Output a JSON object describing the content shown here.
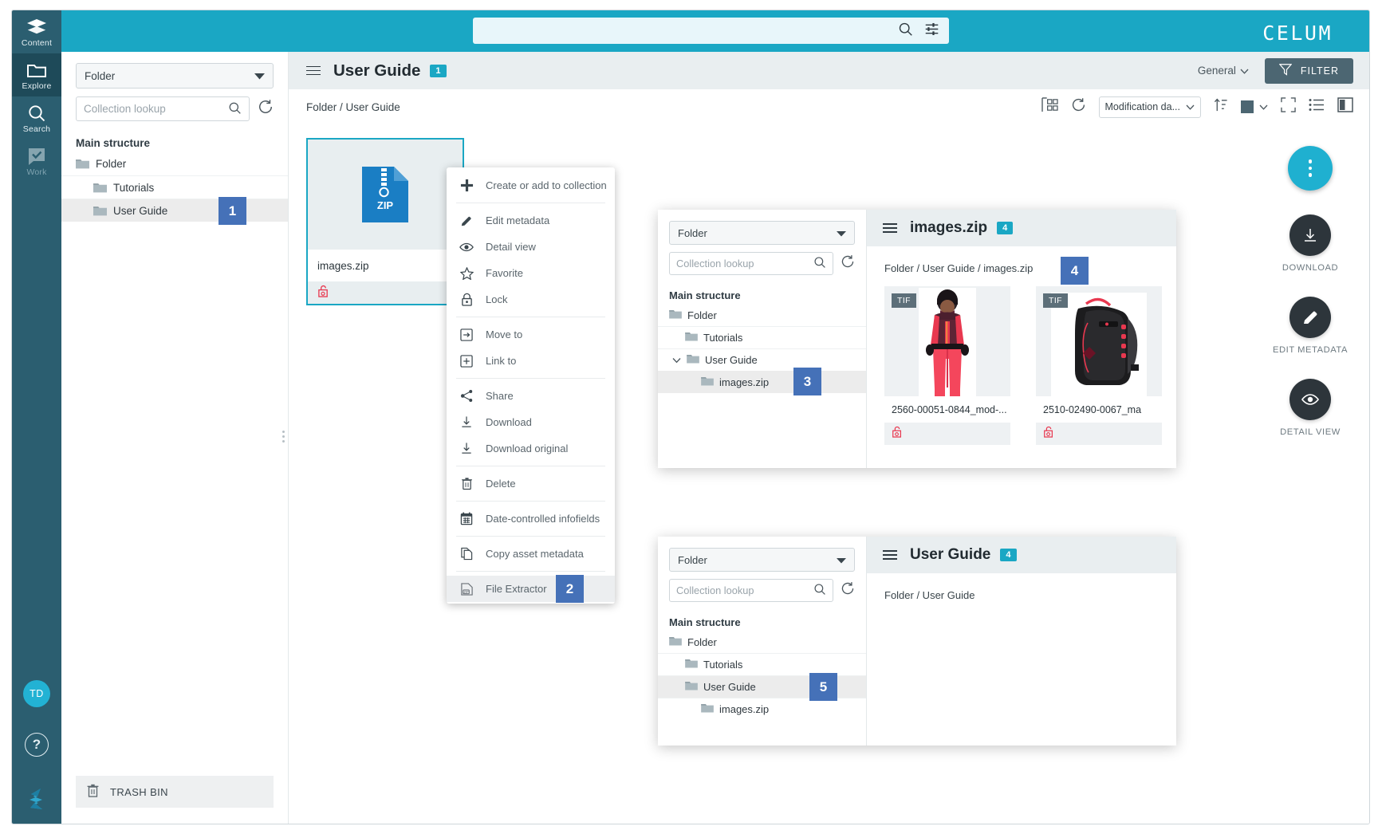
{
  "brand": {
    "logo_text": "CELUM"
  },
  "rail": {
    "items": [
      {
        "label": "Content",
        "icon": "layers-icon",
        "active": false
      },
      {
        "label": "Explore",
        "icon": "folder-icon",
        "active": true
      },
      {
        "label": "Search",
        "icon": "search-icon",
        "active": false
      },
      {
        "label": "Work",
        "icon": "task-check-icon",
        "active": false
      }
    ],
    "avatar_initials": "TD",
    "help_label": "?"
  },
  "top_search": {
    "placeholder": "",
    "value": ""
  },
  "left_panel": {
    "scope_select": "Folder",
    "lookup_placeholder": "Collection lookup",
    "section_title": "Main structure",
    "tree": [
      {
        "label": "Folder",
        "level": 0,
        "selected": false
      },
      {
        "label": "Tutorials",
        "level": 1,
        "selected": false
      },
      {
        "label": "User Guide",
        "level": 1,
        "selected": true,
        "step": "1"
      }
    ],
    "trash_label": "TRASH BIN"
  },
  "main": {
    "title": "User Guide",
    "count": "1",
    "general_label": "General",
    "filter_label": "FILTER",
    "breadcrumb": "Folder / User Guide",
    "sort_value": "Modification da...",
    "asset": {
      "name": "images.zip",
      "type_label": "ZIP"
    }
  },
  "context_menu": {
    "items": [
      {
        "label": "Create or add to collection",
        "icon": "plus-icon",
        "divider_after": true
      },
      {
        "label": "Edit metadata",
        "icon": "pencil-icon"
      },
      {
        "label": "Detail view",
        "icon": "eye-icon"
      },
      {
        "label": "Favorite",
        "icon": "star-icon"
      },
      {
        "label": "Lock",
        "icon": "lock-icon",
        "divider_after": true
      },
      {
        "label": "Move to",
        "icon": "move-to-icon"
      },
      {
        "label": "Link to",
        "icon": "link-to-icon",
        "divider_after": true
      },
      {
        "label": "Share",
        "icon": "share-icon"
      },
      {
        "label": "Download",
        "icon": "download-icon"
      },
      {
        "label": "Download original",
        "icon": "download-original-icon",
        "divider_after": true
      },
      {
        "label": "Delete",
        "icon": "trash-icon",
        "divider_after": true
      },
      {
        "label": "Date-controlled infofields",
        "icon": "calendar-icon",
        "divider_after": true
      },
      {
        "label": "Copy asset metadata",
        "icon": "copy-icon",
        "divider_after": true
      },
      {
        "label": "File Extractor",
        "icon": "zip-extract-icon",
        "highlighted": true,
        "step": "2"
      }
    ]
  },
  "subwindow_zip": {
    "scope_select": "Folder",
    "lookup_placeholder": "Collection lookup",
    "section_title": "Main structure",
    "tree": [
      {
        "label": "Folder",
        "level": 0,
        "selected": false
      },
      {
        "label": "Tutorials",
        "level": 1,
        "selected": false
      },
      {
        "label": "User Guide",
        "level": 1,
        "selected": false,
        "expanded": true
      },
      {
        "label": "images.zip",
        "level": 2,
        "selected": true,
        "step": "3"
      }
    ],
    "title": "images.zip",
    "count": "4",
    "breadcrumb": "Folder / User Guide / images.zip",
    "breadcrumb_step": "4",
    "tiles": [
      {
        "format": "TIF",
        "name": "2560-00051-0844_mod-...",
        "subject": "red-ski-suit-model"
      },
      {
        "format": "TIF",
        "name": "2510-02490-0067_ma",
        "subject": "black-backpack"
      }
    ]
  },
  "subwindow_guide": {
    "scope_select": "Folder",
    "lookup_placeholder": "Collection lookup",
    "section_title": "Main structure",
    "tree": [
      {
        "label": "Folder",
        "level": 0,
        "selected": false
      },
      {
        "label": "Tutorials",
        "level": 1,
        "selected": false
      },
      {
        "label": "User Guide",
        "level": 1,
        "selected": true,
        "step": "5"
      },
      {
        "label": "images.zip",
        "level": 2,
        "selected": false
      }
    ],
    "title": "User Guide",
    "count": "4",
    "breadcrumb": "Folder / User Guide"
  },
  "actions": [
    {
      "label": "DOWNLOAD",
      "icon": "download-icon"
    },
    {
      "label": "EDIT METADATA",
      "icon": "pencil-icon"
    },
    {
      "label": "DETAIL VIEW",
      "icon": "eye-icon"
    }
  ],
  "colors": {
    "brand_cyan": "#1aa7c4",
    "rail_teal": "#2b5e70",
    "step_blue": "#4571b8",
    "filter_slate": "#4c6672",
    "zip_blue": "#1a7ec4"
  }
}
